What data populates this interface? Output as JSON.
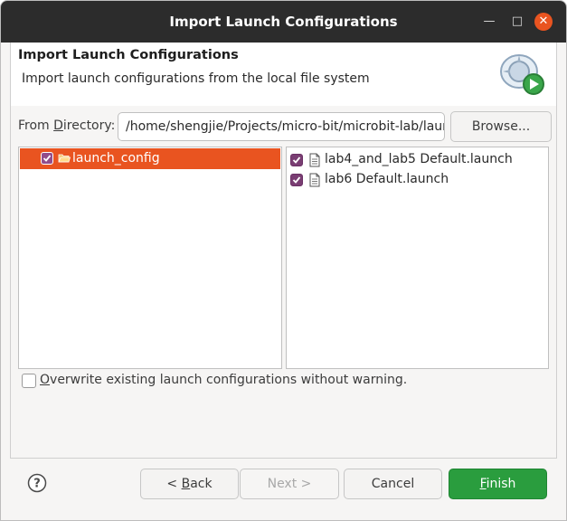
{
  "window": {
    "title": "Import Launch Configurations"
  },
  "header": {
    "title": "Import Launch Configurations",
    "description": "Import launch configurations from the local file system",
    "icon": "import-wizard-icon"
  },
  "directory": {
    "label_pre": "From ",
    "label_mnemonic": "D",
    "label_post": "irectory:",
    "value": "/home/shengjie/Projects/micro-bit/microbit-lab/launch_config",
    "browse_pre": "Browse",
    "browse_mnemonic": "",
    "browse_post": "..."
  },
  "folders": [
    {
      "label": "launch_config",
      "checked": true,
      "selected": true
    }
  ],
  "files": [
    {
      "label": "lab4_and_lab5 Default.launch",
      "checked": true
    },
    {
      "label": "lab6 Default.launch",
      "checked": true
    }
  ],
  "overwrite": {
    "mnemonic": "O",
    "label_rest": "verwrite existing launch configurations without warning.",
    "checked": false
  },
  "buttons": {
    "back_pre": "< ",
    "back_mnemonic": "B",
    "back_post": "ack",
    "next": "Next >",
    "cancel": "Cancel",
    "finish_mnemonic": "F",
    "finish_post": "inish",
    "help": "?"
  },
  "colors": {
    "selection": "#e95420",
    "checkbox": "#7a3e73",
    "finish": "#2a9d3e",
    "titlebar": "#2c2c2c"
  }
}
